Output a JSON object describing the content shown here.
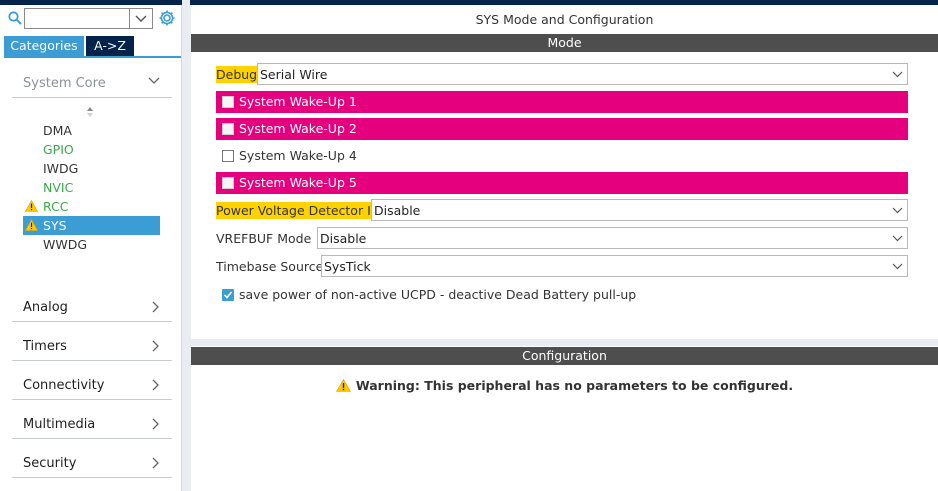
{
  "search": {
    "placeholder": ""
  },
  "tabs": {
    "categories": "Categories",
    "az": "A->Z"
  },
  "categories": {
    "system_core": "System Core",
    "analog": "Analog",
    "timers": "Timers",
    "connectivity": "Connectivity",
    "multimedia": "Multimedia",
    "security": "Security"
  },
  "peripherals": [
    {
      "name": "DMA",
      "state": "normal"
    },
    {
      "name": "GPIO",
      "state": "enabled"
    },
    {
      "name": "IWDG",
      "state": "normal"
    },
    {
      "name": "NVIC",
      "state": "enabled"
    },
    {
      "name": "RCC",
      "state": "warning"
    },
    {
      "name": "SYS",
      "state": "selected-warning"
    },
    {
      "name": "WWDG",
      "state": "normal"
    }
  ],
  "main": {
    "title": "SYS Mode and Configuration",
    "mode_header": "Mode",
    "config_header": "Configuration",
    "debug": {
      "label": "Debug",
      "value": "Serial Wire"
    },
    "wakeups": [
      {
        "label": "System Wake-Up 1",
        "checked": false,
        "conflict": true
      },
      {
        "label": "System Wake-Up 2",
        "checked": false,
        "conflict": true
      },
      {
        "label": "System Wake-Up 4",
        "checked": false,
        "conflict": false
      },
      {
        "label": "System Wake-Up 5",
        "checked": false,
        "conflict": true
      }
    ],
    "pvd": {
      "label": "Power Voltage Detector In",
      "value": "Disable"
    },
    "vrefbuf": {
      "label": "VREFBUF Mode",
      "value": "Disable"
    },
    "timebase": {
      "label": "Timebase Source",
      "value": "SysTick"
    },
    "save_power": {
      "label": "save power of non-active UCPD - deactive Dead Battery pull-up",
      "checked": true
    },
    "warning": "Warning: This peripheral has no parameters to be configured."
  },
  "colors": {
    "accent": "#3c9cd4",
    "navy": "#03234b",
    "conflict": "#e5007d",
    "highlight": "#ffd200",
    "enabled_text": "#3aa84a",
    "bar": "#4e4e4e"
  }
}
